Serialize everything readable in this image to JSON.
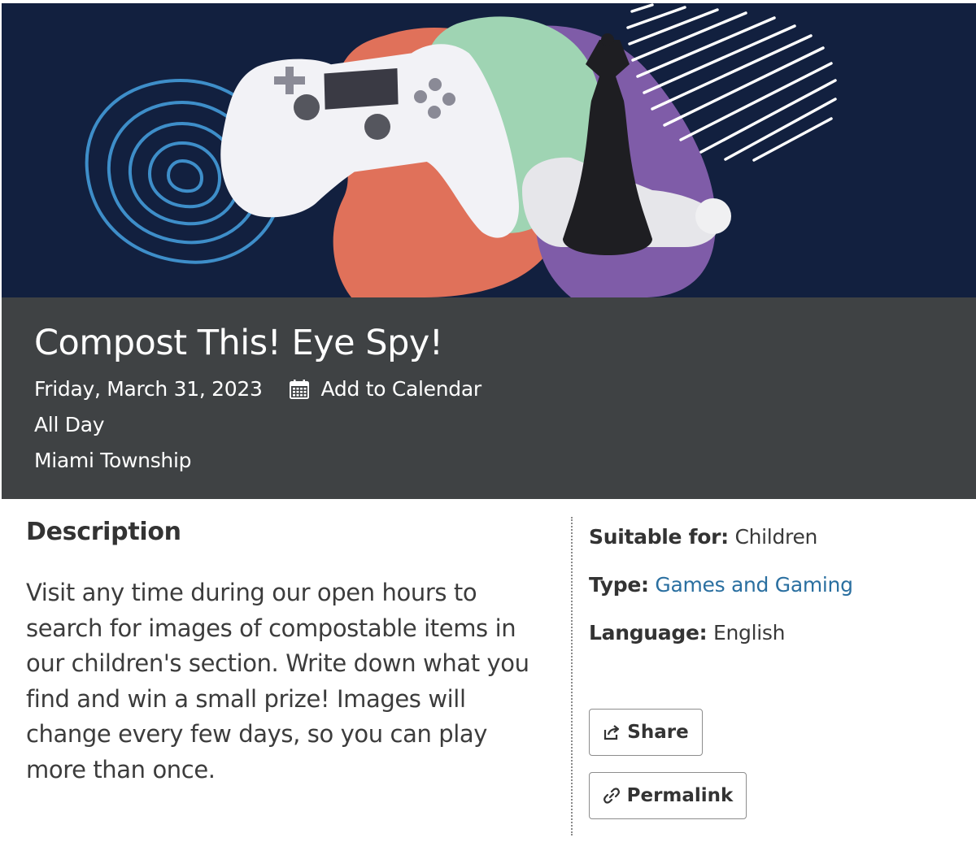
{
  "event": {
    "title": "Compost This! Eye Spy!",
    "date": "Friday, March 31, 2023",
    "add_to_calendar": "Add to Calendar",
    "time": "All Day",
    "location": "Miami Township"
  },
  "description": {
    "heading": "Description",
    "body": "Visit any time during our open hours to search for images of compostable items in our children's section.  Write down what you find and win a small prize!  Images will change every few days, so you can play more than once."
  },
  "details": {
    "suitable_label": "Suitable for:",
    "suitable_value": "Children",
    "type_label": "Type:",
    "type_value": "Games and Gaming",
    "language_label": "Language:",
    "language_value": "English"
  },
  "buttons": {
    "share": "Share",
    "permalink": "Permalink"
  },
  "icons": {
    "calendar": "calendar-icon",
    "share": "share-icon",
    "permalink": "link-icon"
  },
  "colors": {
    "banner_bg": "#12203f",
    "header_bg": "#3f4244",
    "link": "#2a6fa0",
    "orange": "#e0715a",
    "green": "#9fd4b3",
    "purple": "#7f5ca8",
    "blue_lines": "#3e8ec9"
  }
}
